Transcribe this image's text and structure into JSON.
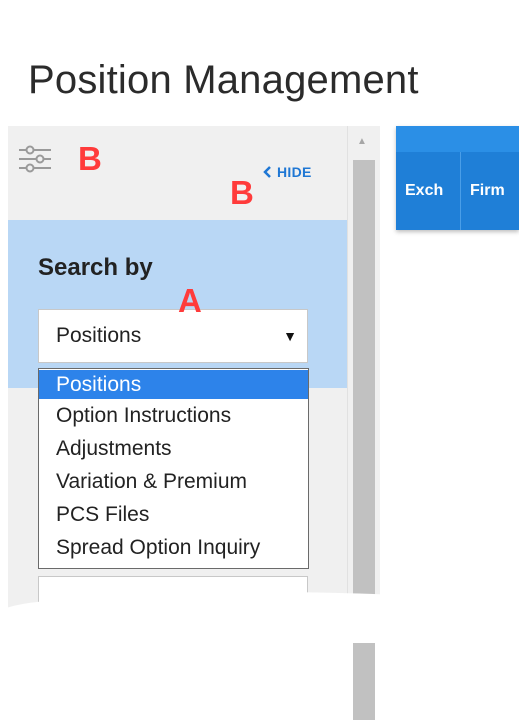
{
  "page": {
    "title": "Position Management"
  },
  "sidebar": {
    "hide_label": "HIDE",
    "search_by_label": "Search by",
    "search_select": {
      "value": "Positions",
      "options": [
        "Positions",
        "Option Instructions",
        "Adjustments",
        "Variation & Premium",
        "PCS Files",
        "Spread Option Inquiry"
      ],
      "selected_index": 0
    }
  },
  "annotations": {
    "b1": "B",
    "b2": "B",
    "a": "A"
  },
  "grid": {
    "columns": [
      "Exch",
      "Firm"
    ]
  },
  "colors": {
    "accent": "#1f7fd7",
    "selected_option": "#2d83ea",
    "search_panel": "#b9d7f5",
    "annotation": "#ff3b3b"
  },
  "icons": {
    "filter": "sliders-icon",
    "hide": "chevron-left-icon",
    "caret": "caret-down-icon",
    "scroll_up": "scroll-up-arrow-icon"
  }
}
